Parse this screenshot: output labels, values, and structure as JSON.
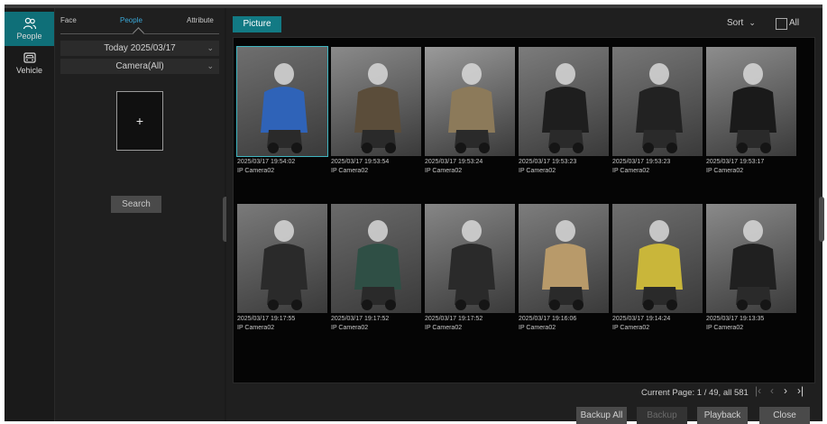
{
  "sidebar": {
    "items": [
      {
        "label": "People",
        "icon": "people-icon",
        "active": true
      },
      {
        "label": "Vehicle",
        "icon": "vehicle-icon",
        "active": false
      }
    ]
  },
  "filter": {
    "tabs": [
      "Face",
      "People",
      "Attribute"
    ],
    "active_tab": "People",
    "date_select": "Today 2025/03/17",
    "camera_select": "Camera(All)",
    "add_label": "+",
    "search_label": "Search"
  },
  "main": {
    "view_button": "Picture",
    "sort_label": "Sort",
    "all_label": "All",
    "results": [
      {
        "time": "2025/03/17 19:54:02",
        "camera": "IP Camera02",
        "tone": "#2f63b8",
        "bg": "#6f6f6f"
      },
      {
        "time": "2025/03/17 19:53:54",
        "camera": "IP Camera02",
        "tone": "#5b4d3a",
        "bg": "#8a8a8a"
      },
      {
        "time": "2025/03/17 19:53:24",
        "camera": "IP Camera02",
        "tone": "#8c7a5a",
        "bg": "#9a9a9a"
      },
      {
        "time": "2025/03/17 19:53:23",
        "camera": "IP Camera02",
        "tone": "#1e1e1e",
        "bg": "#7c7c7c"
      },
      {
        "time": "2025/03/17 19:53:23",
        "camera": "IP Camera02",
        "tone": "#222222",
        "bg": "#777777"
      },
      {
        "time": "2025/03/17 19:53:17",
        "camera": "IP Camera02",
        "tone": "#1a1a1a",
        "bg": "#8d8d8d"
      },
      {
        "time": "2025/03/17 19:17:55",
        "camera": "IP Camera02",
        "tone": "#2a2a2a",
        "bg": "#7a7a7a"
      },
      {
        "time": "2025/03/17 19:17:52",
        "camera": "IP Camera02",
        "tone": "#2f4f45",
        "bg": "#6a6a6a"
      },
      {
        "time": "2025/03/17 19:17:52",
        "camera": "IP Camera02",
        "tone": "#2a2a2a",
        "bg": "#868686"
      },
      {
        "time": "2025/03/17 19:16:06",
        "camera": "IP Camera02",
        "tone": "#b89a6a",
        "bg": "#7d7d7d"
      },
      {
        "time": "2025/03/17 19:14:24",
        "camera": "IP Camera02",
        "tone": "#c9b63a",
        "bg": "#6e6e6e"
      },
      {
        "time": "2025/03/17 19:13:35",
        "camera": "IP Camera02",
        "tone": "#202020",
        "bg": "#8a8a8a"
      }
    ],
    "pagination": "Current Page: 1 / 49, all 581",
    "buttons": {
      "backup_all": "Backup All",
      "backup": "Backup",
      "playback": "Playback",
      "close": "Close"
    }
  },
  "colors": {
    "accent": "#127a84",
    "selected_outline": "#3fb5c0"
  }
}
